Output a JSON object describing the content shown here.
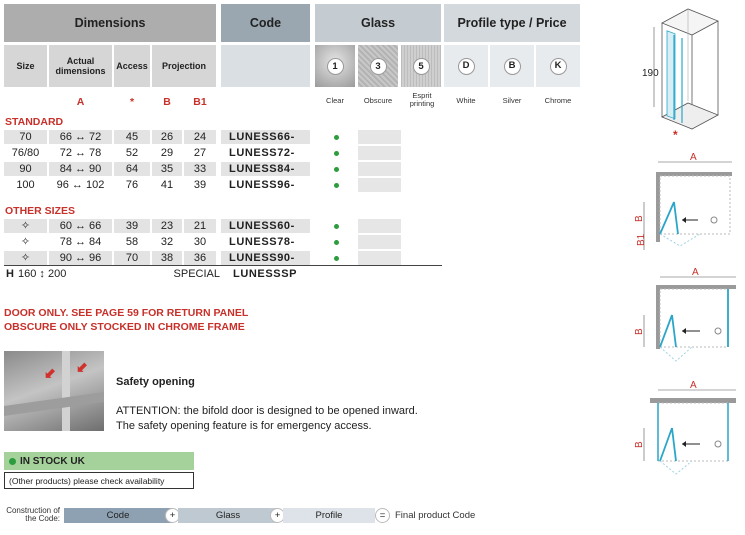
{
  "headers": {
    "dimensions": "Dimensions",
    "code": "Code",
    "glass": "Glass",
    "profile": "Profile type / Price"
  },
  "subheaders": {
    "size": "Size",
    "actual": "Actual dimensions",
    "access": "Access",
    "projection": "Projection"
  },
  "glass_options": [
    {
      "num": "1",
      "label": "Clear"
    },
    {
      "num": "3",
      "label": "Obscure"
    },
    {
      "num": "5",
      "label": "Esprit printing"
    }
  ],
  "profile_options": [
    {
      "letter": "D",
      "label": "White"
    },
    {
      "letter": "B",
      "label": "Silver"
    },
    {
      "letter": "K",
      "label": "Chrome"
    }
  ],
  "column_letters": {
    "a": "A",
    "access": "*",
    "b": "B",
    "b1": "B1"
  },
  "sections": {
    "standard": "STANDARD",
    "other": "OTHER SIZES"
  },
  "standard_rows": [
    {
      "size": "70",
      "actual": "66 ↔ 72",
      "access": "45",
      "b": "26",
      "b1": "24",
      "code": "LUNESS66-"
    },
    {
      "size": "76/80",
      "actual": "72 ↔ 78",
      "access": "52",
      "b": "29",
      "b1": "27",
      "code": "LUNESS72-"
    },
    {
      "size": "90",
      "actual": "84 ↔ 90",
      "access": "64",
      "b": "35",
      "b1": "33",
      "code": "LUNESS84-"
    },
    {
      "size": "100",
      "actual": "96 ↔ 102",
      "access": "76",
      "b": "41",
      "b1": "39",
      "code": "LUNESS96-"
    }
  ],
  "other_rows": [
    {
      "size": "✧",
      "actual": "60 ↔ 66",
      "access": "39",
      "b": "23",
      "b1": "21",
      "code": "LUNESS60-"
    },
    {
      "size": "✧",
      "actual": "78 ↔ 84",
      "access": "58",
      "b": "32",
      "b1": "30",
      "code": "LUNESS78-"
    },
    {
      "size": "✧",
      "actual": "90 ↔ 96",
      "access": "70",
      "b": "38",
      "b1": "36",
      "code": "LUNESS90-"
    }
  ],
  "special_row": {
    "h_label": "H",
    "h_range": "160 ↕ 200",
    "special": "SPECIAL",
    "code": "LUNESSSP"
  },
  "notes": [
    "DOOR ONLY. SEE PAGE 59 FOR RETURN PANEL",
    "OBSCURE ONLY STOCKED IN CHROME FRAME"
  ],
  "safety": {
    "title": "Safety opening",
    "line1": "ATTENTION: the bifold door is designed to be opened inward.",
    "line2": "The safety opening feature is for emergency access."
  },
  "stock": {
    "label": "IN STOCK UK",
    "other": "(Other products) please check availability"
  },
  "construction": {
    "label": "Construction of the Code:",
    "code": "Code",
    "glass": "Glass",
    "profile": "Profile",
    "plus": "+",
    "equals": "=",
    "final": "Final product Code"
  },
  "diagram_labels": {
    "height": "190",
    "access_mark": "*",
    "a": "A",
    "b": "B",
    "b1": "B1"
  },
  "colors": {
    "accent_red": "#c8302a",
    "stock_green": "#2c9c3e",
    "glass_blue": "#2aa6c9"
  }
}
